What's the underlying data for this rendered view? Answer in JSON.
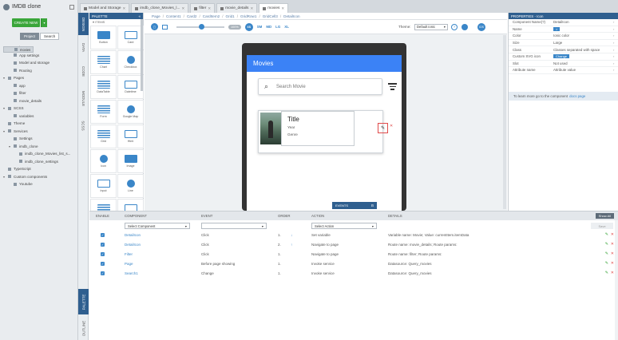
{
  "app": {
    "title": "IMDB clone",
    "create_label": "CREATE NEW",
    "tabs": [
      "Project",
      "Search"
    ]
  },
  "tree": [
    {
      "label": "Project",
      "indent": 0,
      "tw": "▾"
    },
    {
      "label": "App settings",
      "indent": 1
    },
    {
      "label": "Model and storage",
      "indent": 1
    },
    {
      "label": "Routing",
      "indent": 1
    },
    {
      "label": "Pages",
      "indent": 0,
      "tw": "▾"
    },
    {
      "label": "app",
      "indent": 1
    },
    {
      "label": "filter",
      "indent": 1
    },
    {
      "label": "movie_details",
      "indent": 1
    },
    {
      "label": "movies",
      "indent": 1,
      "selected": true
    },
    {
      "label": "SCSS",
      "indent": 0,
      "tw": "▾"
    },
    {
      "label": "variables",
      "indent": 1
    },
    {
      "label": "Theme",
      "indent": 0
    },
    {
      "label": "Services",
      "indent": 0,
      "tw": "▾"
    },
    {
      "label": "Settings",
      "indent": 1
    },
    {
      "label": "imdb_clone",
      "indent": 1,
      "tw": "▾"
    },
    {
      "label": "imdb_clone_Movies_list_s...",
      "indent": 2
    },
    {
      "label": "imdb_clone_settings",
      "indent": 2
    },
    {
      "label": "TypeScript",
      "indent": 0
    },
    {
      "label": "Custom components",
      "indent": 0,
      "tw": "▾"
    },
    {
      "label": "Youtube",
      "indent": 1
    }
  ],
  "tabs": [
    {
      "label": "Model and Storage",
      "active": false
    },
    {
      "label": "imdb_clone_Movies_l...",
      "active": false
    },
    {
      "label": "filter",
      "active": false
    },
    {
      "label": "movie_details",
      "active": false
    },
    {
      "label": "movies",
      "active": true
    }
  ],
  "side_tabs": [
    "DESIGN",
    "DATA",
    "CODE",
    "MODULE",
    "SCSS"
  ],
  "bottom_tabs": [
    "PALETTE",
    "OUTLINE"
  ],
  "palette": {
    "title": "PALETTE",
    "section": "ITEMS",
    "items": [
      "Button",
      "Card",
      "Chart",
      "Checkbox",
      "DataTable",
      "Datetime",
      "Form",
      "Google Map",
      "Grid",
      "Html",
      "Icon",
      "Image",
      "Input",
      "Line",
      "List",
      "Radiogroup"
    ]
  },
  "breadcrumb": [
    "Page",
    "Content1",
    "Card2",
    "CardItem2",
    "Grid1",
    "GridRow1",
    "GridCell3",
    "DetailIcon"
  ],
  "toolbar": {
    "zoom": "100%",
    "breakpoints": [
      "XS",
      "SM",
      "MD",
      "LG",
      "XL"
    ],
    "theme_label": "Theme:",
    "theme_value": "Default ionic",
    "ios": "IOS"
  },
  "phone": {
    "header": "Movies",
    "search_placeholder": "Search Movie",
    "card_title": "Title",
    "card_year": "Year",
    "card_genre": "Genre"
  },
  "events_tab": "EVENTS",
  "properties": {
    "title": "PROPERTIES - Icon",
    "rows": [
      {
        "k": "Component Name(?)",
        "v": "DetailIcon"
      },
      {
        "k": "Name",
        "v": ">",
        "btn": true
      },
      {
        "k": "Color",
        "v": "Ionic color"
      },
      {
        "k": "Size",
        "v": "Large"
      },
      {
        "k": "Class",
        "v": "Classes separated with space"
      },
      {
        "k": "Custom SVG icon",
        "v": "Change",
        "btn": true
      },
      {
        "k": "Slot",
        "v": "Not used"
      },
      {
        "k": "Attribute name",
        "v": "Attribute value"
      }
    ],
    "note": "To learn more go to the component",
    "note_link": "docs page"
  },
  "events": {
    "headers": [
      "ENABLE",
      "COMPONENT",
      "EVENT",
      "ORDER",
      "ACTION",
      "DETAILS"
    ],
    "show_all": "Show All",
    "filter_component": "Select Component",
    "filter_action": "Select Action",
    "save": "Save",
    "rows": [
      {
        "component": "DetailIcon",
        "event": "Click",
        "order": "1.",
        "arrow": "↓",
        "action": "Set variable",
        "details": "Variable name: Movie; Value: currentItem.itemData"
      },
      {
        "component": "DetailIcon",
        "event": "Click",
        "order": "2.",
        "arrow": "↑",
        "action": "Navigate to page",
        "details": "Route name: movie_details; Route params:"
      },
      {
        "component": "Filter",
        "event": "Click",
        "order": "1.",
        "arrow": "",
        "action": "Navigate to page",
        "details": "Route name: filter; Route params:"
      },
      {
        "component": "Page",
        "event": "Before page showing",
        "order": "1.",
        "arrow": "",
        "action": "Invoke service",
        "details": "Datasource: Query_movies"
      },
      {
        "component": "Search1",
        "event": "Change",
        "order": "1.",
        "arrow": "",
        "action": "Invoke service",
        "details": "Datasource: Query_movies"
      }
    ]
  },
  "colors": {
    "accent": "#3a86c8",
    "header_blue": "#3b82f6",
    "panel_head": "#2f5f8f",
    "create_green": "#3aa63a"
  }
}
